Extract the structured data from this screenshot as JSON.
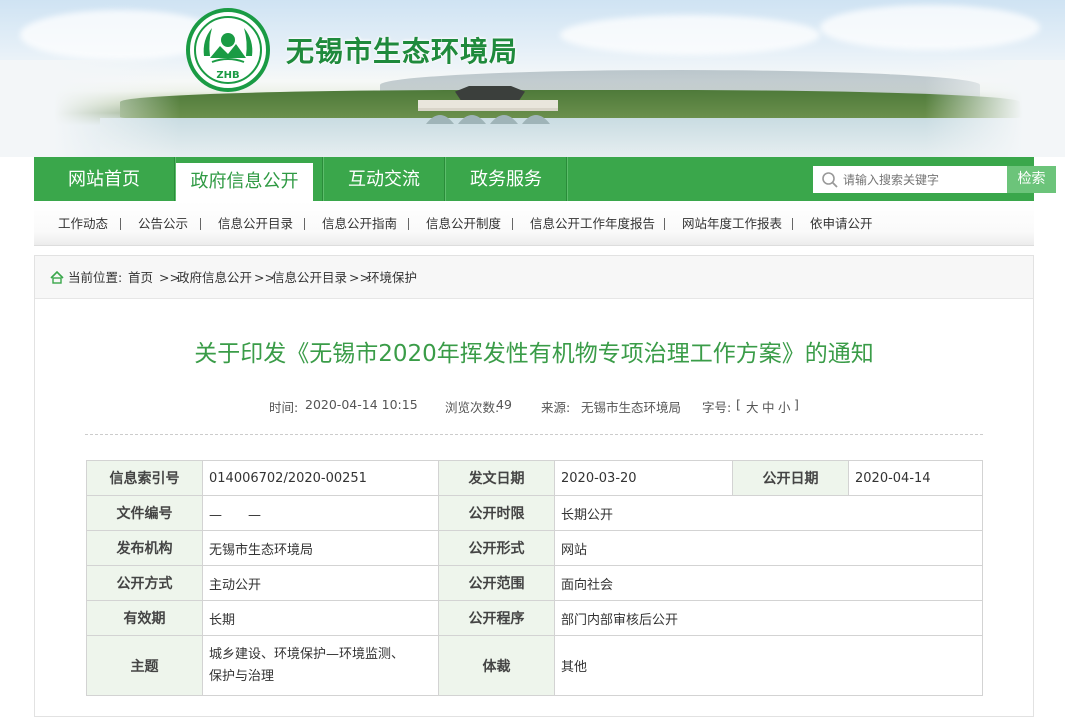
{
  "header": {
    "site_title": "无锡市生态环境局",
    "logo_text": "ZHB"
  },
  "nav": {
    "tabs": [
      "网站首页",
      "政府信息公开",
      "互动交流",
      "政务服务"
    ],
    "active_tab": "政府信息公开",
    "search_placeholder": "请输入搜索关键字",
    "search_button": "检索"
  },
  "subnav": {
    "items": [
      "工作动态",
      "公告公示",
      "信息公开目录",
      "信息公开指南",
      "信息公开制度",
      "信息公开工作年度报告",
      "网站年度工作报表",
      "依申请公开"
    ]
  },
  "breadcrumb": {
    "label": "当前位置:",
    "items": [
      "首页",
      "政府信息公开",
      "信息公开目录",
      "环境保护"
    ],
    "separator": ">>"
  },
  "article": {
    "title": "关于印发《无锡市2020年挥发性有机物专项治理工作方案》的通知",
    "time_label": "时间:",
    "time": "2020-04-14 10:15",
    "views_label": "浏览次数:",
    "views": "49",
    "source_label": "来源:",
    "source": "无锡市生态环境局",
    "font_label": "字号:",
    "font_open": "[",
    "font_sizes": [
      "大",
      "中",
      "小"
    ],
    "font_close": "]"
  },
  "info_table": {
    "row1": {
      "l1": "信息索引号",
      "v1": "014006702/2020-00251",
      "l2": "发文日期",
      "v2": "2020-03-20",
      "l3": "公开日期",
      "v3": "2020-04-14"
    },
    "row2": {
      "l1": "文件编号",
      "v1": "—　　—",
      "l2": "公开时限",
      "v2": "长期公开"
    },
    "row3": {
      "l1": "发布机构",
      "v1": "无锡市生态环境局",
      "l2": "公开形式",
      "v2": "网站"
    },
    "row4": {
      "l1": "公开方式",
      "v1": "主动公开",
      "l2": "公开范围",
      "v2": "面向社会"
    },
    "row5": {
      "l1": "有效期",
      "v1": "长期",
      "l2": "公开程序",
      "v2": "部门内部审核后公开"
    },
    "row6": {
      "l1": "主题",
      "v1a": "城乡建设、环境保护—环境监测、",
      "v1b": "保护与治理",
      "l2": "体裁",
      "v2": "其他"
    }
  },
  "colors": {
    "brand_green": "#3aa74b",
    "title_green": "#3a9c48",
    "table_header_bg": "#eef5ec"
  }
}
